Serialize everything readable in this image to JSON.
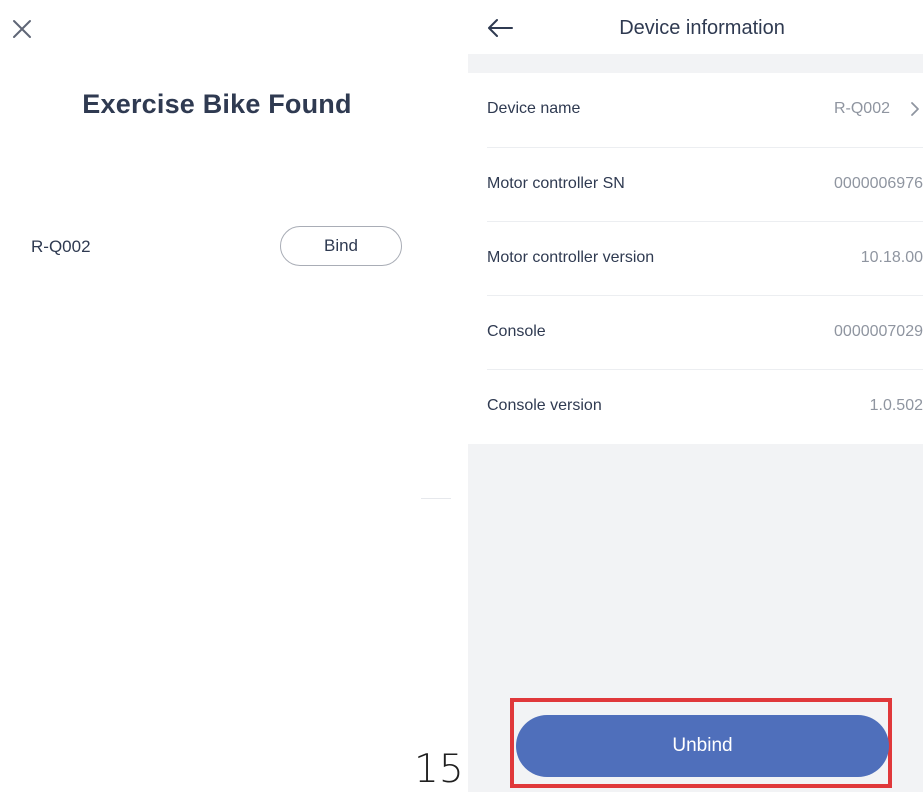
{
  "left_screen": {
    "title": "Exercise Bike Found",
    "found_device": {
      "name": "R-Q002",
      "bind_label": "Bind"
    },
    "page_number": "15"
  },
  "right_screen": {
    "header": {
      "title": "Device information"
    },
    "rows": [
      {
        "label": "Device name",
        "value": "R-Q002"
      },
      {
        "label": "Motor controller SN",
        "value": "0000006976"
      },
      {
        "label": "Motor controller version",
        "value": "10.18.00"
      },
      {
        "label": "Console",
        "value": "0000007029"
      },
      {
        "label": "Console version",
        "value": "1.0.502"
      }
    ],
    "unbind_label": "Unbind"
  },
  "icons": {
    "close": "close-icon",
    "back": "arrow-left-icon",
    "chevron": "chevron-right-icon"
  },
  "colors": {
    "primary_button": "#4f6fbb",
    "highlight_frame": "#e0383a",
    "text_primary": "#2f3a51",
    "text_secondary": "#8f95a0",
    "background_grey": "#f2f3f5"
  }
}
